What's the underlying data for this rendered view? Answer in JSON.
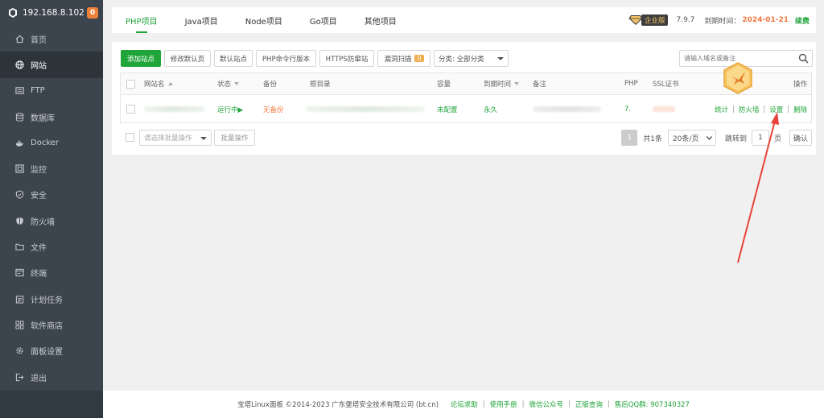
{
  "sidebar": {
    "ip": "192.168.8.102",
    "badge": "0",
    "items": [
      {
        "label": "首页",
        "icon": "home-icon"
      },
      {
        "label": "网站",
        "icon": "globe-icon",
        "active": true
      },
      {
        "label": "FTP",
        "icon": "ftp-icon"
      },
      {
        "label": "数据库",
        "icon": "database-icon"
      },
      {
        "label": "Docker",
        "icon": "docker-icon"
      },
      {
        "label": "监控",
        "icon": "monitor-icon"
      },
      {
        "label": "安全",
        "icon": "shield-icon"
      },
      {
        "label": "防火墙",
        "icon": "firewall-icon"
      },
      {
        "label": "文件",
        "icon": "folder-icon"
      },
      {
        "label": "终端",
        "icon": "terminal-icon"
      },
      {
        "label": "计划任务",
        "icon": "calendar-icon"
      },
      {
        "label": "软件商店",
        "icon": "apps-icon"
      },
      {
        "label": "面板设置",
        "icon": "gear-icon"
      },
      {
        "label": "退出",
        "icon": "logout-icon"
      }
    ]
  },
  "tabs": [
    "PHP项目",
    "Java项目",
    "Node项目",
    "Go项目",
    "其他项目"
  ],
  "header": {
    "edition": "企业版",
    "version": "7.9.7",
    "expire_label": "到期时间：",
    "expire_date": "2024-01-21",
    "renew": "续费"
  },
  "toolbar": {
    "add_site": "添加站点",
    "edit_default_page": "修改默认页",
    "default_site": "默认站点",
    "php_cli": "PHP命令行版本",
    "https_block": "HTTPS防窜站",
    "vuln_scan": "漏洞扫描",
    "vuln_count": "0",
    "category": "分类: 全部分类",
    "search_placeholder": "请输入域名或备注"
  },
  "table": {
    "headers": {
      "name": "网站名",
      "status": "状态",
      "backup": "备份",
      "root": "根目录",
      "capacity": "容量",
      "expire": "到期时间",
      "note": "备注",
      "php": "PHP",
      "ssl": "SSL证书",
      "ops": "操作"
    },
    "rows": [
      {
        "status": "运行中▶",
        "backup": "无备份",
        "capacity": "未配置",
        "expire": "永久",
        "php": "7.",
        "ops": [
          "统计",
          "防火墙",
          "设置",
          "删除"
        ]
      }
    ]
  },
  "batch": {
    "select_placeholder": "请选择批量操作",
    "button": "批量操作"
  },
  "pager": {
    "current": "1",
    "total": "共1条",
    "per_page": "20条/页",
    "jump_label": "跳转到",
    "jump_value": "1",
    "page_unit": "页",
    "confirm": "确认"
  },
  "footer": {
    "copyright": "宝塔Linux面板 ©2014-2023 广东堡塔安全技术有限公司 (bt.cn)",
    "links": [
      "论坛求助",
      "使用手册",
      "微信公众号",
      "正版查询",
      "售后QQ群: 907340327"
    ]
  },
  "colors": {
    "accent": "#20a53a",
    "sidebar_bg": "#3c444d",
    "orange": "#f2783d",
    "annotation_arrow": "#e8433a"
  }
}
